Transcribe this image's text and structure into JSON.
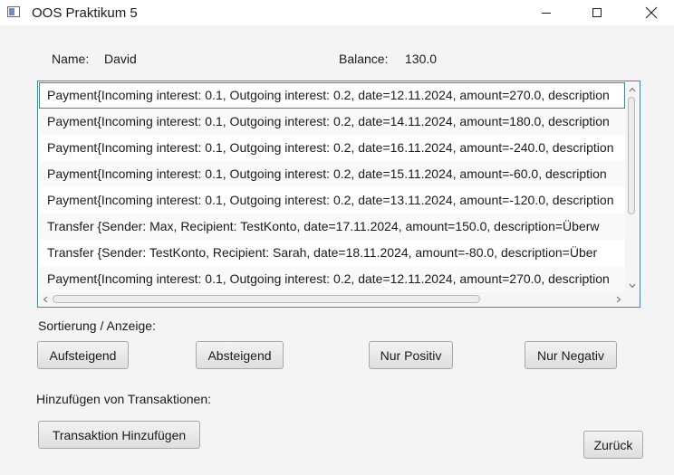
{
  "window": {
    "title": "OOS Praktikum 5"
  },
  "account": {
    "name_label": "Name:",
    "name_value": "David",
    "balance_label": "Balance:",
    "balance_value": "130.0"
  },
  "transactions": [
    "Payment{Incoming interest: 0.1, Outgoing interest: 0.2, date=12.11.2024, amount=270.0, description",
    "Payment{Incoming interest: 0.1, Outgoing interest: 0.2, date=14.11.2024, amount=180.0, description",
    "Payment{Incoming interest: 0.1, Outgoing interest: 0.2, date=16.11.2024, amount=-240.0, description",
    "Payment{Incoming interest: 0.1, Outgoing interest: 0.2, date=15.11.2024, amount=-60.0, description",
    "Payment{Incoming interest: 0.1, Outgoing interest: 0.2, date=13.11.2024, amount=-120.0, description",
    "Transfer {Sender: Max, Recipient: TestKonto, date=17.11.2024, amount=150.0, description=Überw",
    "Transfer {Sender: TestKonto, Recipient: Sarah, date=18.11.2024, amount=-80.0, description=Über",
    "Payment{Incoming interest: 0.1, Outgoing interest: 0.2, date=12.11.2024, amount=270.0, description"
  ],
  "sort": {
    "label": "Sortierung / Anzeige:",
    "ascending": "Aufsteigend",
    "descending": "Absteigend",
    "only_positive": "Nur Positiv",
    "only_negative": "Nur Negativ"
  },
  "add": {
    "label": "Hinzufügen von Transaktionen:",
    "add_button": "Transaktion Hinzufügen"
  },
  "back_button": "Zurück",
  "colors": {
    "focus_border": "#1d8fd8",
    "window_bg": "#f4f4f4"
  },
  "icons": {
    "app": "java-app-icon",
    "minimize": "minimize-icon",
    "maximize": "maximize-icon",
    "close": "close-icon"
  }
}
